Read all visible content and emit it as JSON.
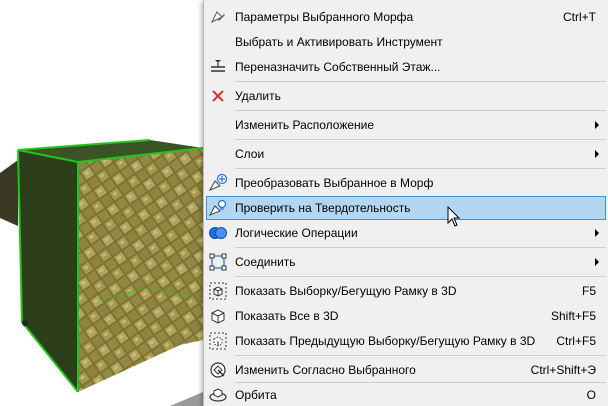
{
  "menu": {
    "items": [
      {
        "label": "Параметры Выбранного Морфа",
        "shortcut": "Ctrl+T",
        "icon": "morph-settings-icon"
      },
      {
        "label": "Выбрать и Активировать Инструмент",
        "shortcut": "",
        "icon": ""
      },
      {
        "label": "Переназначить Собственный Этаж...",
        "shortcut": "",
        "icon": "home-story-icon"
      },
      {
        "label": "Удалить",
        "shortcut": "",
        "icon": "delete-x-icon"
      },
      {
        "label": "Изменить Расположение",
        "shortcut": "",
        "icon": "",
        "submenu": true
      },
      {
        "label": "Слои",
        "shortcut": "",
        "icon": "",
        "submenu": true
      },
      {
        "label": "Преобразовать Выбранное в Морф",
        "shortcut": "",
        "icon": "convert-to-morph-icon"
      },
      {
        "label": "Проверить на Твердотельность",
        "shortcut": "",
        "icon": "check-solidity-icon",
        "highlighted": true
      },
      {
        "label": "Логические Операции",
        "shortcut": "",
        "icon": "boolean-operations-icon",
        "submenu": true
      },
      {
        "label": "Соединить",
        "shortcut": "",
        "icon": "connect-icon",
        "submenu": true
      },
      {
        "label": "Показать Выборку/Бегущую Рамку в 3D",
        "shortcut": "F5",
        "icon": "show-selection-3d-icon"
      },
      {
        "label": "Показать Все в 3D",
        "shortcut": "Shift+F5",
        "icon": "show-all-3d-icon"
      },
      {
        "label": "Показать Предыдущую Выборку/Бегущую Рамку в 3D",
        "shortcut": "Ctrl+F5",
        "icon": "show-previous-3d-icon"
      },
      {
        "label": "Изменить Согласно Выбранного",
        "shortcut": "Ctrl+Shift+Э",
        "icon": "modify-by-selection-icon"
      },
      {
        "label": "Орбита",
        "shortcut": "O",
        "icon": "orbit-icon"
      }
    ]
  },
  "colors": {
    "highlight_fill": "#b3d7f3",
    "highlight_border": "#3c8fd3",
    "delete_red": "#e0312c",
    "selection_green": "#22c31e",
    "boolean_blue": "#1e6fe0"
  }
}
